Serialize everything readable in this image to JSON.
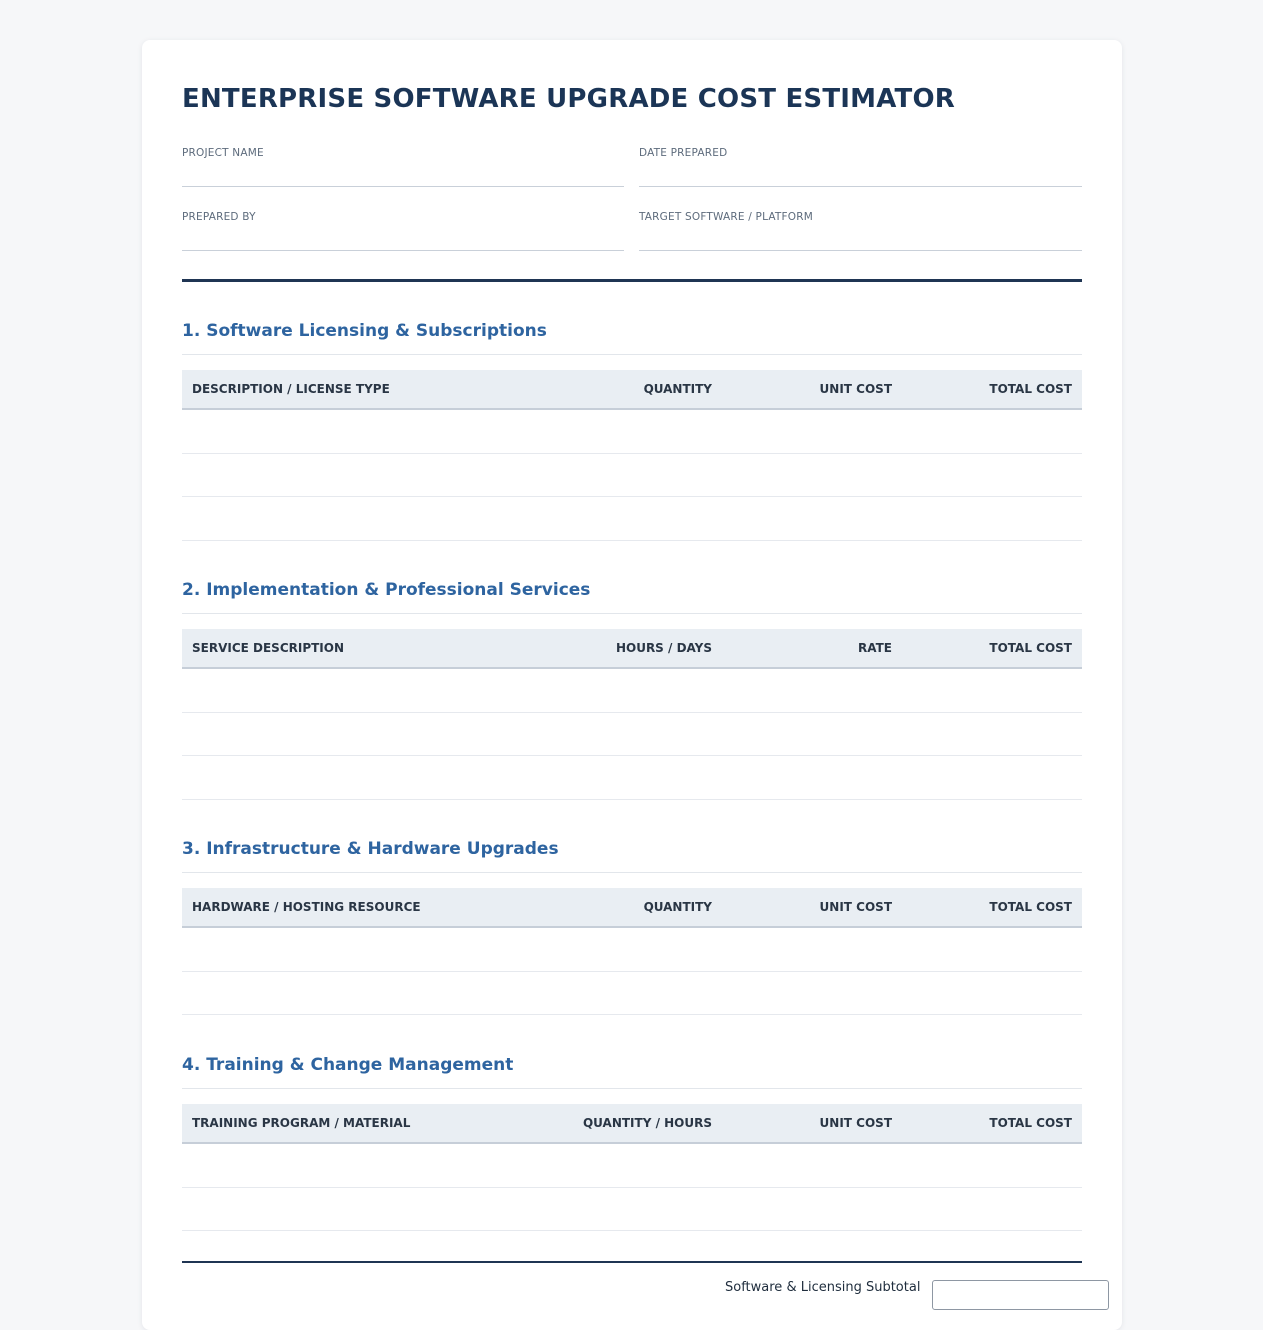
{
  "title": "ENTERPRISE SOFTWARE UPGRADE COST ESTIMATOR",
  "meta": {
    "project_name_label": "PROJECT NAME",
    "date_prepared_label": "DATE PREPARED",
    "prepared_by_label": "PREPARED BY",
    "target_label": "TARGET SOFTWARE / PLATFORM"
  },
  "sections": [
    {
      "title": "1. Software Licensing & Subscriptions",
      "columns": [
        "DESCRIPTION / LICENSE TYPE",
        "QUANTITY",
        "UNIT COST",
        "TOTAL COST"
      ]
    },
    {
      "title": "2. Implementation & Professional Services",
      "columns": [
        "SERVICE DESCRIPTION",
        "HOURS / DAYS",
        "RATE",
        "TOTAL COST"
      ]
    },
    {
      "title": "3. Infrastructure & Hardware Upgrades",
      "columns": [
        "HARDWARE / HOSTING RESOURCE",
        "QUANTITY",
        "UNIT COST",
        "TOTAL COST"
      ]
    },
    {
      "title": "4. Training & Change Management",
      "columns": [
        "TRAINING PROGRAM / MATERIAL",
        "QUANTITY / HOURS",
        "UNIT COST",
        "TOTAL COST"
      ]
    }
  ],
  "summary": {
    "software_subtotal_label": "Software & Licensing Subtotal"
  }
}
